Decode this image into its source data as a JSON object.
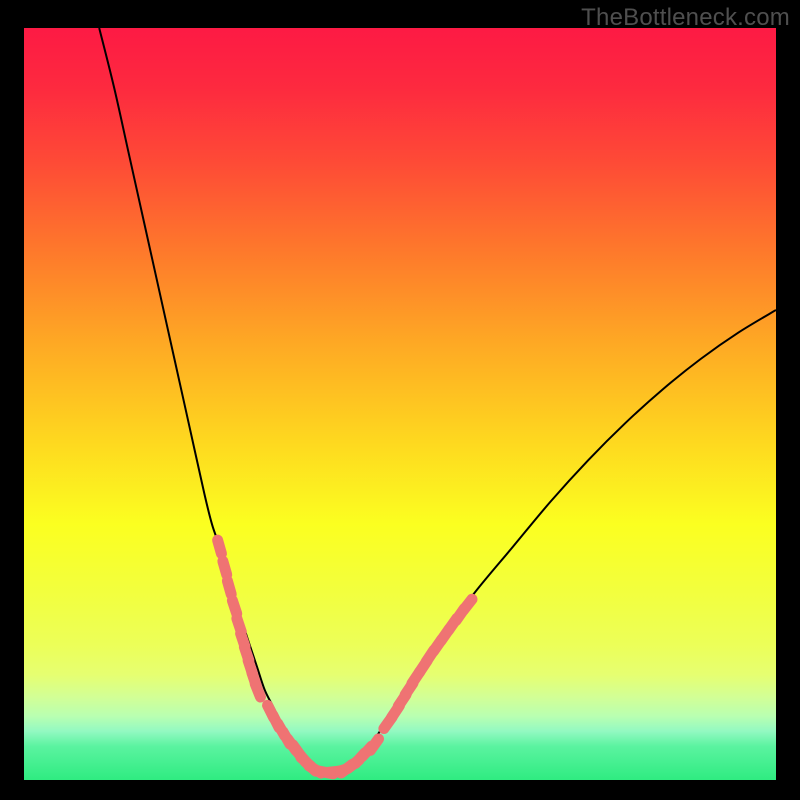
{
  "watermark": "TheBottleneck.com",
  "gradient": {
    "stops": [
      {
        "offset": "0%",
        "color": "#fd1a44"
      },
      {
        "offset": "8%",
        "color": "#fd2a3f"
      },
      {
        "offset": "18%",
        "color": "#fe4b36"
      },
      {
        "offset": "30%",
        "color": "#fe7a2b"
      },
      {
        "offset": "42%",
        "color": "#fea924"
      },
      {
        "offset": "55%",
        "color": "#fed81f"
      },
      {
        "offset": "66%",
        "color": "#fbff20"
      },
      {
        "offset": "75%",
        "color": "#f2ff3e"
      },
      {
        "offset": "82%",
        "color": "#ecff58"
      },
      {
        "offset": "86%",
        "color": "#e6ff71"
      },
      {
        "offset": "89%",
        "color": "#d2ff96"
      },
      {
        "offset": "91.5%",
        "color": "#b9ffb1"
      },
      {
        "offset": "93.5%",
        "color": "#93f9c2"
      },
      {
        "offset": "95.5%",
        "color": "#5bf3a0"
      },
      {
        "offset": "100%",
        "color": "#2fec81"
      }
    ]
  },
  "dot_stroke": "#ef7373",
  "dot_fill": "#ef7373",
  "curve_color": "#000000",
  "chart_data": {
    "type": "line",
    "title": "",
    "xlabel": "",
    "ylabel": "",
    "xlim": [
      0,
      100
    ],
    "ylim": [
      0,
      100
    ],
    "series": [
      {
        "name": "bottleneck-curve",
        "x": [
          10,
          12,
          14,
          16,
          18,
          20,
          22,
          24,
          25,
          26,
          27,
          28,
          29,
          30,
          31,
          32,
          33,
          34,
          35,
          36,
          37,
          38,
          39,
          40,
          41,
          42,
          43,
          45,
          47,
          50,
          53,
          56,
          60,
          65,
          70,
          75,
          80,
          85,
          90,
          95,
          100
        ],
        "y": [
          100,
          92,
          83,
          74,
          65,
          56,
          47,
          38,
          34,
          31,
          27,
          24,
          21,
          18,
          15,
          12,
          10,
          8,
          6,
          4.5,
          3.2,
          2.2,
          1.4,
          1,
          1,
          1.2,
          1.6,
          3.5,
          6,
          10.5,
          15,
          19.5,
          25,
          31,
          37,
          42.5,
          47.5,
          52,
          56,
          59.5,
          62.5
        ]
      },
      {
        "name": "dots-left-upper",
        "x": [
          26.0,
          26.7,
          27.3,
          28.0,
          28.6,
          29.1,
          29.6,
          30.1,
          30.6,
          31.1
        ],
        "y": [
          31.0,
          28.2,
          25.6,
          23.0,
          20.6,
          18.6,
          16.8,
          15.0,
          13.4,
          11.9
        ]
      },
      {
        "name": "dots-left-lower",
        "x": [
          32.8,
          33.5,
          34.2,
          34.9,
          35.6,
          36.3,
          36.9,
          37.5,
          38.1,
          38.7
        ],
        "y": [
          9.1,
          7.8,
          6.7,
          5.6,
          4.7,
          3.9,
          3.1,
          2.4,
          1.8,
          1.4
        ]
      },
      {
        "name": "dots-bottom",
        "x": [
          40.2,
          41.2,
          42.0,
          42.9,
          43.8,
          44.7,
          45.6,
          46.6
        ],
        "y": [
          1.0,
          1.1,
          1.2,
          1.5,
          2.1,
          2.9,
          3.8,
          4.7
        ]
      },
      {
        "name": "dots-right",
        "x": [
          48.4,
          49.4,
          50.3,
          51.2,
          52.1,
          53.1,
          54.0,
          55.0,
          56.0,
          57.0,
          58.0,
          59.0
        ],
        "y": [
          7.6,
          9.1,
          10.6,
          12.1,
          13.6,
          15.1,
          16.5,
          17.9,
          19.3,
          20.7,
          22.0,
          23.3
        ]
      }
    ]
  }
}
